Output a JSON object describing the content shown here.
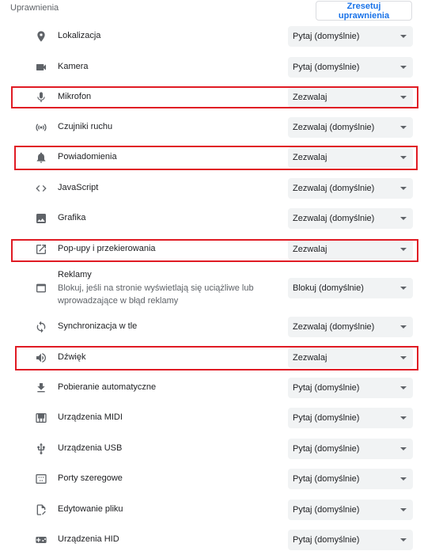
{
  "header": {
    "title": "Uprawnienia",
    "reset_label": "Zresetuj uprawnienia"
  },
  "colors": {
    "highlight": "#e01b24",
    "icon": "#5f6368",
    "accent": "#1a73e8"
  },
  "permissions": [
    {
      "label": "Lokalizacja",
      "icon": "location-icon",
      "value": "Pytaj (domyślnie)",
      "highlighted": false
    },
    {
      "label": "Kamera",
      "icon": "camera-icon",
      "value": "Pytaj (domyślnie)",
      "highlighted": false
    },
    {
      "label": "Mikrofon",
      "icon": "microphone-icon",
      "value": "Zezwalaj",
      "highlighted": true
    },
    {
      "label": "Czujniki ruchu",
      "icon": "motion-sensors-icon",
      "value": "Zezwalaj (domyślnie)",
      "highlighted": false
    },
    {
      "label": "Powiadomienia",
      "icon": "bell-icon",
      "value": "Zezwalaj",
      "highlighted": true
    },
    {
      "label": "JavaScript",
      "icon": "code-icon",
      "value": "Zezwalaj (domyślnie)",
      "highlighted": false
    },
    {
      "label": "Grafika",
      "icon": "image-icon",
      "value": "Zezwalaj (domyślnie)",
      "highlighted": false
    },
    {
      "label": "Pop-upy i przekierowania",
      "icon": "popup-icon",
      "value": "Zezwalaj",
      "highlighted": true
    },
    {
      "label": "Reklamy",
      "sublabel": "Blokuj, jeśli na stronie wyświetlają się uciążliwe lub wprowadzające w błąd reklamy",
      "icon": "ads-icon",
      "value": "Blokuj (domyślnie)",
      "highlighted": false
    },
    {
      "label": "Synchronizacja w tle",
      "icon": "sync-icon",
      "value": "Zezwalaj (domyślnie)",
      "highlighted": false
    },
    {
      "label": "Dźwięk",
      "icon": "sound-icon",
      "value": "Zezwalaj",
      "highlighted": true
    },
    {
      "label": "Pobieranie automatyczne",
      "icon": "download-icon",
      "value": "Pytaj (domyślnie)",
      "highlighted": false
    },
    {
      "label": "Urządzenia MIDI",
      "icon": "midi-icon",
      "value": "Pytaj (domyślnie)",
      "highlighted": false
    },
    {
      "label": "Urządzenia USB",
      "icon": "usb-icon",
      "value": "Pytaj (domyślnie)",
      "highlighted": false
    },
    {
      "label": "Porty szeregowe",
      "icon": "serial-port-icon",
      "value": "Pytaj (domyślnie)",
      "highlighted": false
    },
    {
      "label": "Edytowanie pliku",
      "icon": "file-edit-icon",
      "value": "Pytaj (domyślnie)",
      "highlighted": false
    },
    {
      "label": "Urządzenia HID",
      "icon": "hid-device-icon",
      "value": "Pytaj (domyślnie)",
      "highlighted": false
    }
  ]
}
